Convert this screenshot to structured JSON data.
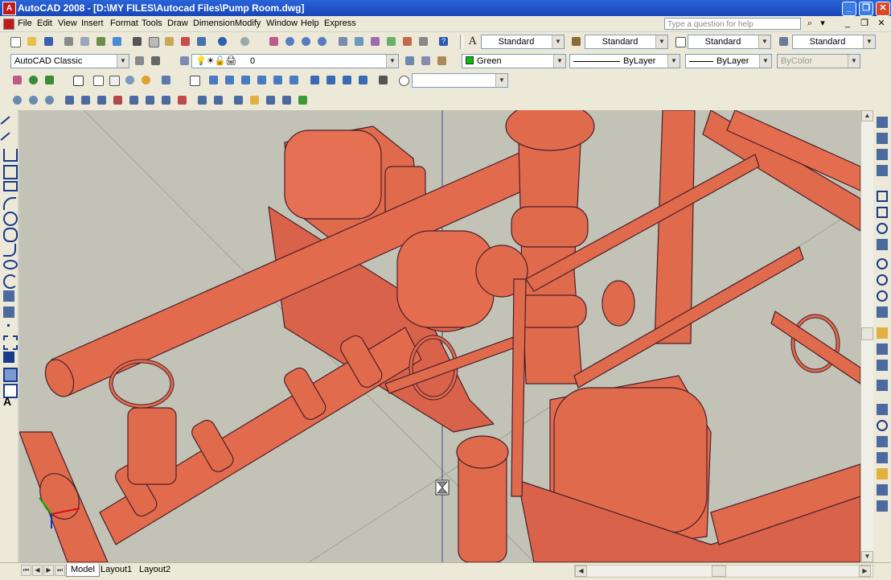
{
  "window": {
    "title": "AutoCAD 2008 - [D:\\MY FILES\\Autocad Files\\Pump Room.dwg]",
    "app_icon_letter": "A",
    "minimize": "_",
    "restore": "❐",
    "close": "✕"
  },
  "menu": {
    "items": [
      "File",
      "Edit",
      "View",
      "Insert",
      "Format",
      "Tools",
      "Draw",
      "Dimension",
      "Modify",
      "Window",
      "Help",
      "Express"
    ],
    "help_placeholder": "Type a question for help"
  },
  "toolbar_styles": {
    "text_style": "Standard",
    "dim_style": "Standard",
    "table_style": "Standard",
    "multileader_style": "Standard"
  },
  "toolbar_layers": {
    "workspace": "AutoCAD Classic",
    "layer": "0",
    "color": "Green",
    "linetype": "ByLayer",
    "lineweight": "ByLayer",
    "plotstyle": "ByColor"
  },
  "toolbar_views": {
    "named_view": ""
  },
  "tabs": [
    "Model",
    "Layout1",
    "Layout2"
  ],
  "colors": {
    "model_fill": "#e06a4c",
    "model_edge": "#4a1e2a",
    "viewport_bg": "#c2c2b6",
    "layer_swatch": "#00c000",
    "title_bar": "#2a64d8"
  },
  "icons": {
    "ucs": "ucs-icon",
    "crosshair_cursor": "hourglass-cursor-icon"
  }
}
